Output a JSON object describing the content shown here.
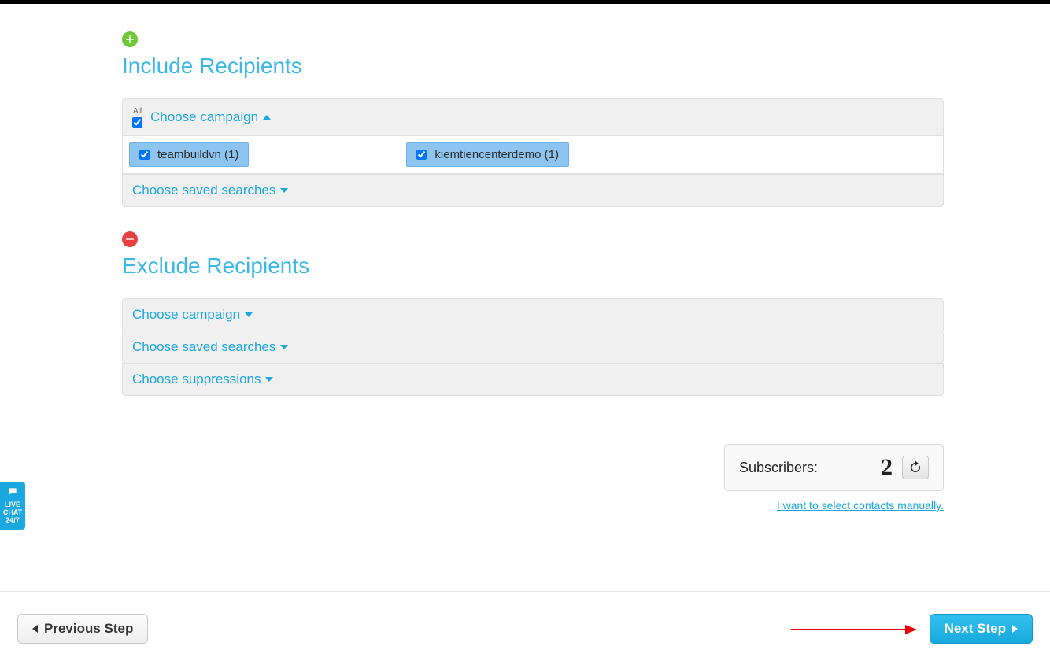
{
  "include": {
    "title": "Include Recipients",
    "all_label": "All",
    "choose_campaign": "Choose campaign",
    "campaigns": [
      {
        "label": "teambuildvn (1)",
        "checked": true
      },
      {
        "label": "kiemtiencenterdemo (1)",
        "checked": true
      }
    ],
    "choose_saved_searches": "Choose saved searches"
  },
  "exclude": {
    "title": "Exclude Recipients",
    "choose_campaign": "Choose campaign",
    "choose_saved_searches": "Choose saved searches",
    "choose_suppressions": "Choose suppressions"
  },
  "subscribers": {
    "label": "Subscribers:",
    "count": "2",
    "manual_link": "I want to select contacts manually."
  },
  "footer": {
    "prev": "Previous Step",
    "next": "Next Step"
  },
  "chat": {
    "line1": "LIVE",
    "line2": "CHAT",
    "line3": "24/7"
  }
}
